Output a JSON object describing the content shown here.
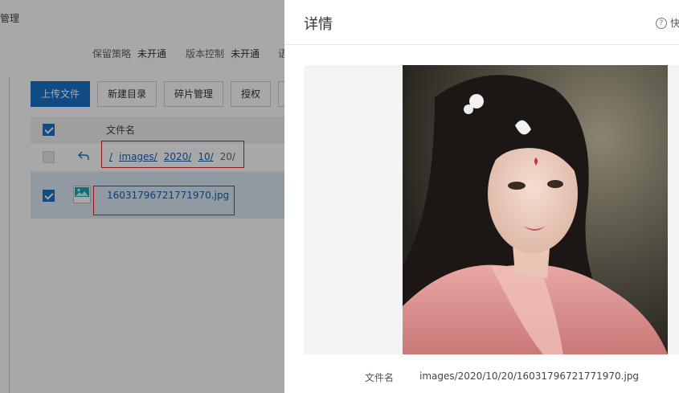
{
  "background": {
    "title_fragment": "管理",
    "status": [
      {
        "label": "保留策略",
        "value": "未开通"
      },
      {
        "label": "版本控制",
        "value": "未开通"
      },
      {
        "label": "语",
        "value": ""
      }
    ],
    "toolbar": {
      "upload": "上传文件",
      "new_dir": "新建目录",
      "fragments": "碎片管理",
      "authorize": "授权"
    },
    "table": {
      "col_name": "文件名",
      "path": {
        "root": "/",
        "images": "images/",
        "year": "2020/",
        "month": "10/",
        "current": "20/"
      },
      "file_name": "16031796721771970.jpg"
    }
  },
  "drawer": {
    "title": "详情",
    "help_label": "快",
    "meta": {
      "label": "文件名",
      "value": "images/2020/10/20/16031796721771970.jpg"
    }
  },
  "colors": {
    "primary": "#1a73c8",
    "link": "#1a5fa8",
    "highlight_box": "#e02020",
    "selected_row": "#dde9f6"
  },
  "icons": [
    "back-arrow-icon",
    "image-file-icon",
    "help-circle-icon"
  ]
}
